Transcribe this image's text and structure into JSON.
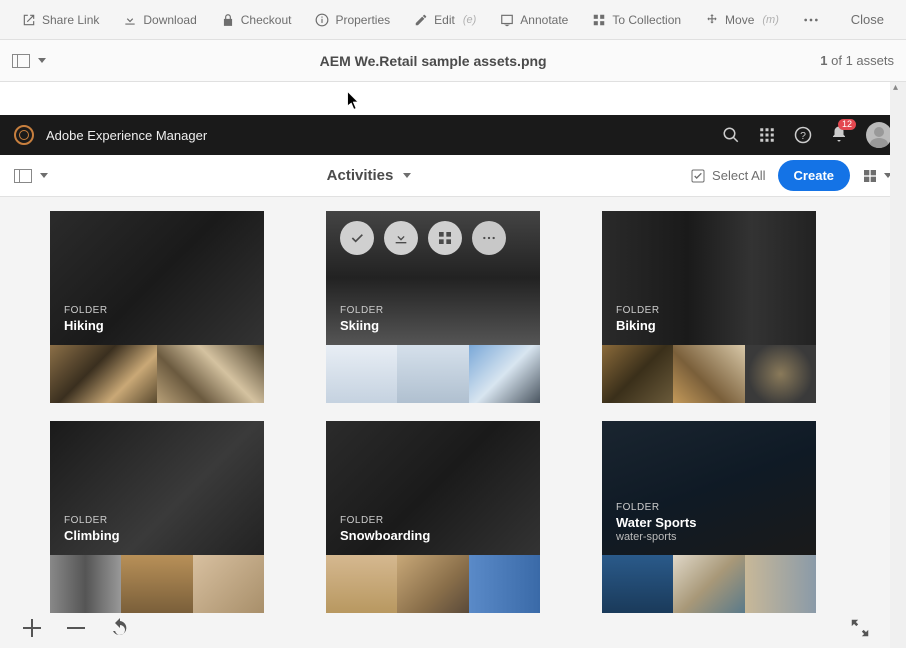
{
  "toolbar": {
    "share": "Share Link",
    "download": "Download",
    "checkout": "Checkout",
    "properties": "Properties",
    "edit": "Edit",
    "edit_shortcut": "(e)",
    "annotate": "Annotate",
    "collection": "To Collection",
    "move": "Move",
    "move_shortcut": "(m)",
    "close": "Close"
  },
  "filebar": {
    "filename": "AEM We.Retail sample assets.png",
    "counter_strong": "1",
    "counter_rest": " of 1 assets"
  },
  "aem": {
    "title": "Adobe Experience Manager",
    "notification_count": "12"
  },
  "activities": {
    "title": "Activities",
    "select_all": "Select All",
    "create": "Create"
  },
  "cards": [
    {
      "type": "FOLDER",
      "title": "Hiking",
      "subtitle": "",
      "hero": "hiking",
      "strip": [
        "t-rock1",
        "t-rock2"
      ]
    },
    {
      "type": "FOLDER",
      "title": "Skiing",
      "subtitle": "",
      "hero": "skiing",
      "hover": true,
      "strip": [
        "t-snow1",
        "t-snow2",
        "t-ski"
      ]
    },
    {
      "type": "FOLDER",
      "title": "Biking",
      "subtitle": "",
      "hero": "biking",
      "strip": [
        "t-bike1",
        "t-bike2",
        "t-bike3"
      ]
    },
    {
      "type": "FOLDER",
      "title": "Climbing",
      "subtitle": "",
      "hero": "climbing",
      "strip": [
        "t-climb1",
        "t-climb2",
        "t-climb3"
      ]
    },
    {
      "type": "FOLDER",
      "title": "Snowboarding",
      "subtitle": "",
      "hero": "hiking",
      "strip": [
        "t-snow3",
        "t-snow4",
        "t-snow5"
      ]
    },
    {
      "type": "FOLDER",
      "title": "Water Sports",
      "subtitle": "water-sports",
      "hero": "water",
      "strip": [
        "t-water1",
        "t-water2",
        "t-water3"
      ]
    }
  ]
}
